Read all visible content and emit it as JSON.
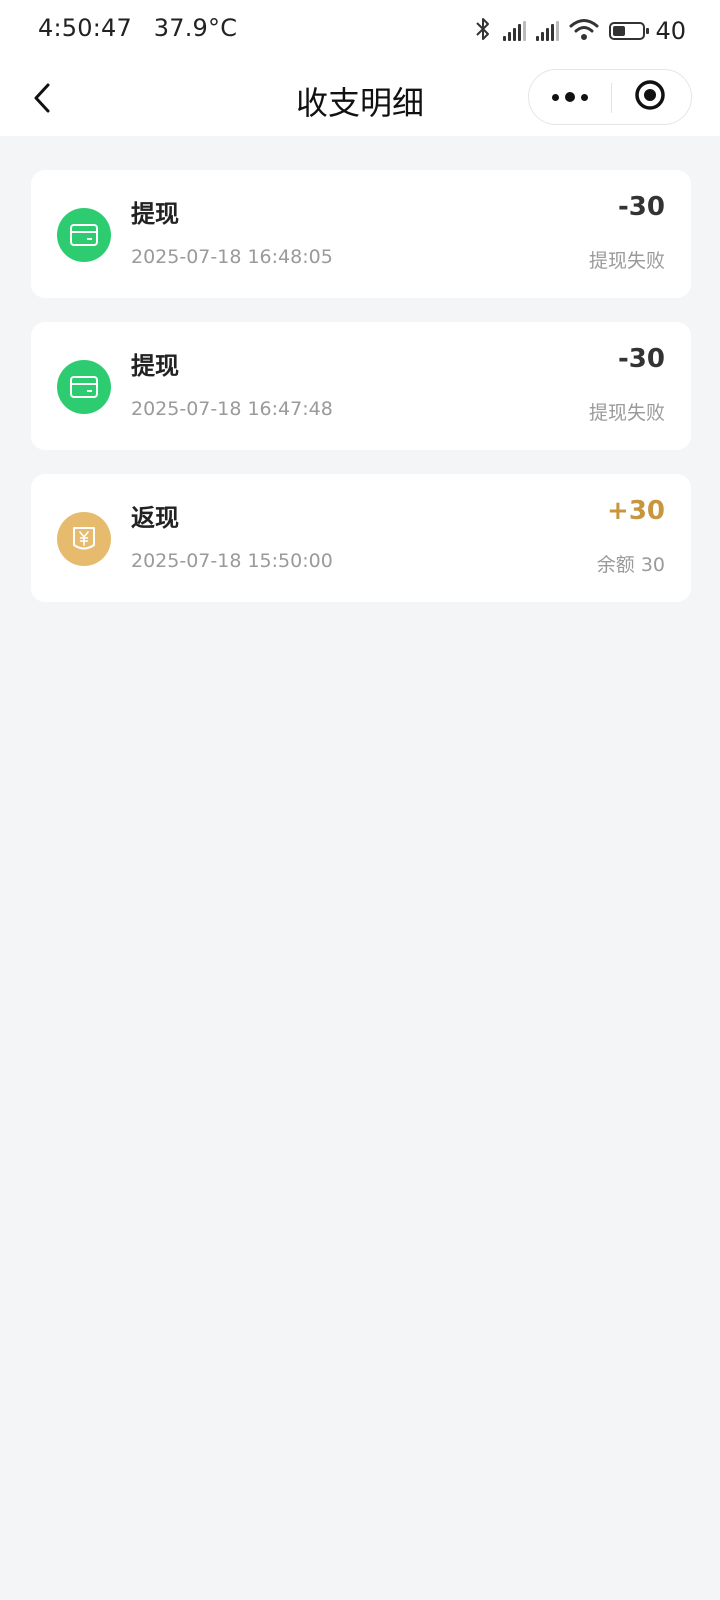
{
  "status_bar": {
    "time": "4:50:47",
    "temperature": "37.9°C",
    "battery": "40",
    "icons": [
      "bluetooth-icon",
      "signal-icon",
      "signal-icon",
      "wifi-icon",
      "battery-icon"
    ]
  },
  "nav": {
    "title": "收支明细",
    "icons": {
      "back": "chevron-left-icon",
      "more": "more-dots-icon",
      "close": "target-circle-icon"
    }
  },
  "transactions": [
    {
      "type": "提现",
      "time": "2025-07-18 16:48:05",
      "amount": "-30",
      "status": "提现失败",
      "icon": "card-icon",
      "icon_color": "#2ecc71",
      "amount_color": "#333333"
    },
    {
      "type": "提现",
      "time": "2025-07-18 16:47:48",
      "amount": "-30",
      "status": "提现失败",
      "icon": "card-icon",
      "icon_color": "#2ecc71",
      "amount_color": "#333333"
    },
    {
      "type": "返现",
      "time": "2025-07-18 15:50:00",
      "amount": "+30",
      "status": "余额 30",
      "icon": "yuan-tag-icon",
      "icon_color": "#e6bb6e",
      "amount_color": "#c8963c"
    }
  ],
  "colors": {
    "background": "#f4f5f7",
    "card": "#ffffff",
    "withdraw_icon": "#2ecc71",
    "cashback_icon": "#e6bb6e",
    "cashback_amount": "#c8963c"
  }
}
